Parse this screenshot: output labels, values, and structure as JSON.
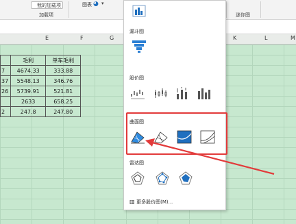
{
  "ribbon": {
    "items": [
      "加载项",
      "图表",
      "迷你图"
    ],
    "top_label": "我的加载项"
  },
  "columns": [
    "E",
    "F",
    "G",
    "K",
    "L",
    "M"
  ],
  "table": {
    "headers": [
      "毛利",
      "单车毛利"
    ],
    "rows": [
      [
        "7",
        "4674.33",
        "333.88"
      ],
      [
        "37",
        "5548.13",
        "346.76"
      ],
      [
        "26",
        "5739.91",
        "521.81"
      ],
      [
        "",
        "2633",
        "658.25"
      ],
      [
        "2",
        "247.8",
        "247.80"
      ]
    ]
  },
  "panel": {
    "sections": {
      "funnel": "漏斗图",
      "stock": "股价图",
      "surface": "曲面图",
      "radar": "雷达图"
    },
    "more": "更多股价图(M)..."
  },
  "colors": {
    "grid_green": "#c7e8cf",
    "highlight_red": "#e23a3a",
    "chart_blue": "#1f6fbf"
  }
}
